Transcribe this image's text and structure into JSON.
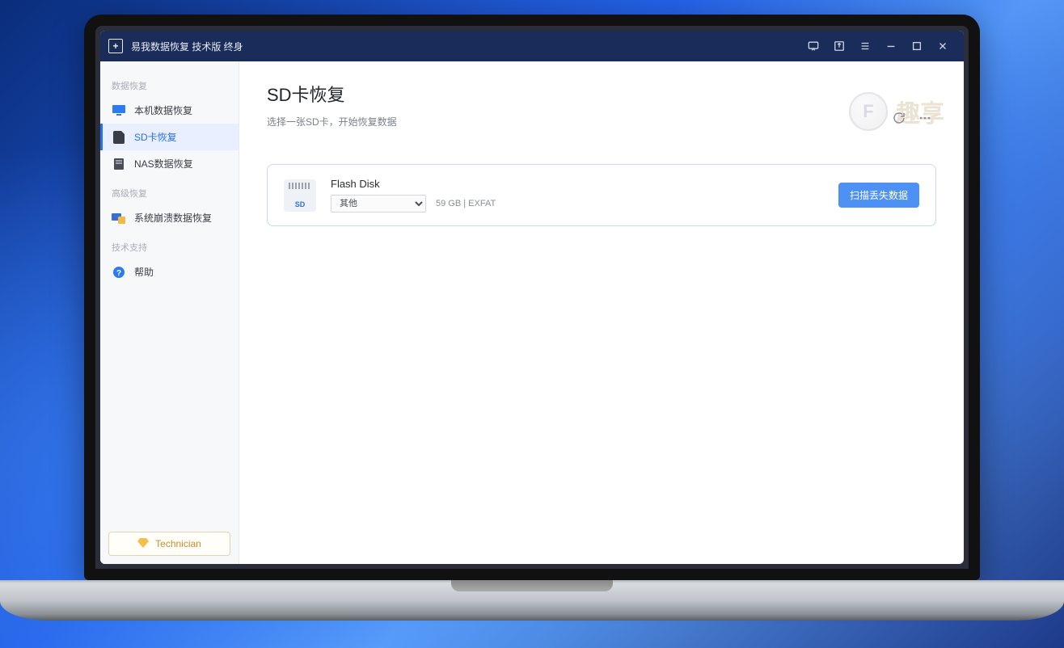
{
  "titlebar": {
    "app_name": "易我数据恢复 技术版 终身"
  },
  "sidebar": {
    "sections": {
      "data_recovery": "数据恢复",
      "advanced_recovery": "高级恢复",
      "tech_support": "技术支持"
    },
    "items": {
      "local": "本机数据恢复",
      "sd": "SD卡恢复",
      "nas": "NAS数据恢复",
      "crash": "系统崩溃数据恢复",
      "help": "帮助"
    },
    "footer_badge": "Technician"
  },
  "main": {
    "title": "SD卡恢复",
    "subtitle": "选择一张SD卡，开始恢复数据",
    "device": {
      "name": "Flash Disk",
      "select_value": "其他",
      "meta": "59 GB | EXFAT",
      "scan_label": "扫描丢失数据"
    }
  },
  "watermark": {
    "letter": "F",
    "text": "趣享"
  },
  "icons": {
    "sd_label": "SD"
  }
}
